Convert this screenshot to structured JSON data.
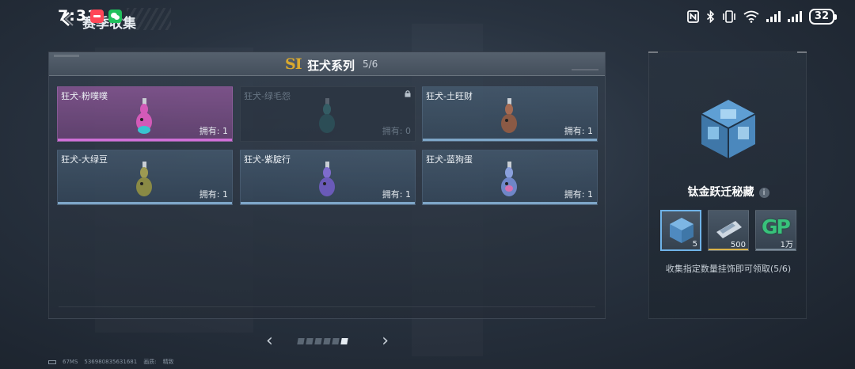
{
  "status_bar": {
    "time": "7:31",
    "battery": "32"
  },
  "page": {
    "title": "赛季收集"
  },
  "collection": {
    "season_mark": "SI",
    "series_title": "狂犬系列",
    "series_count": "5/6",
    "items": [
      {
        "name": "狂犬-粉噗噗",
        "owned": "拥有: 1",
        "style": "pink",
        "color": "#d35ab8"
      },
      {
        "name": "狂犬-绿毛怨",
        "owned": "拥有: 0",
        "style": "locked",
        "color": "#3e8a8e"
      },
      {
        "name": "狂犬-土旺财",
        "owned": "拥有: 1",
        "style": "normal",
        "color": "#8b5a45"
      },
      {
        "name": "狂犬-大绿豆",
        "owned": "拥有: 1",
        "style": "normal",
        "color": "#8a8a45"
      },
      {
        "name": "狂犬-紫腚行",
        "owned": "拥有: 1",
        "style": "normal",
        "color": "#6a5ab8"
      },
      {
        "name": "狂犬-蓝狗蛋",
        "owned": "拥有: 1",
        "style": "normal",
        "color": "#6f86c8"
      }
    ]
  },
  "pagination": {
    "prev": "‹",
    "next": "›",
    "page_count": 6,
    "current_page": 6
  },
  "reward": {
    "title": "钛金跃迁秘藏",
    "info_icon": "i",
    "items": [
      {
        "icon": "crate-icon",
        "qty": "5",
        "bar_color": "#6fb3e8"
      },
      {
        "icon": "ticket-icon",
        "qty": "500",
        "bar_color": "#d9b24a"
      },
      {
        "icon": "gp-icon",
        "label": "GP",
        "qty": "1万",
        "bar_color": "#7a8a99"
      }
    ],
    "description": "收集指定数量挂饰即可领取(5/6)"
  },
  "debug": {
    "ping": "67MS",
    "uid": "536980835631681",
    "quality_label": "画质:",
    "quality_value": "精致"
  }
}
